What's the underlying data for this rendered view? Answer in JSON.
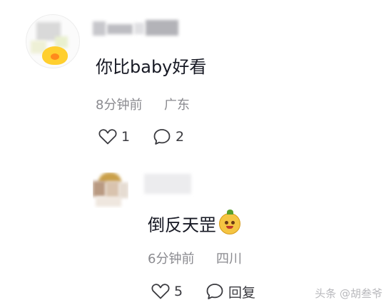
{
  "comment1": {
    "text": "你比baby好看",
    "time": "8分钟前",
    "location": "广东",
    "like_count": "1",
    "reply_count": "2"
  },
  "comment2": {
    "text": "倒反天罡",
    "time": "6分钟前",
    "location": "四川",
    "like_count": "5",
    "reply_label": "回复"
  },
  "watermark": "头条 @胡叁爷",
  "icons": {
    "like": "heart-outline-icon",
    "comment": "speech-bubble-icon",
    "emoji": "smiling-face-emoji"
  },
  "colors": {
    "text": "#161823",
    "meta": "#8a8a8f",
    "background": "#ffffff"
  }
}
